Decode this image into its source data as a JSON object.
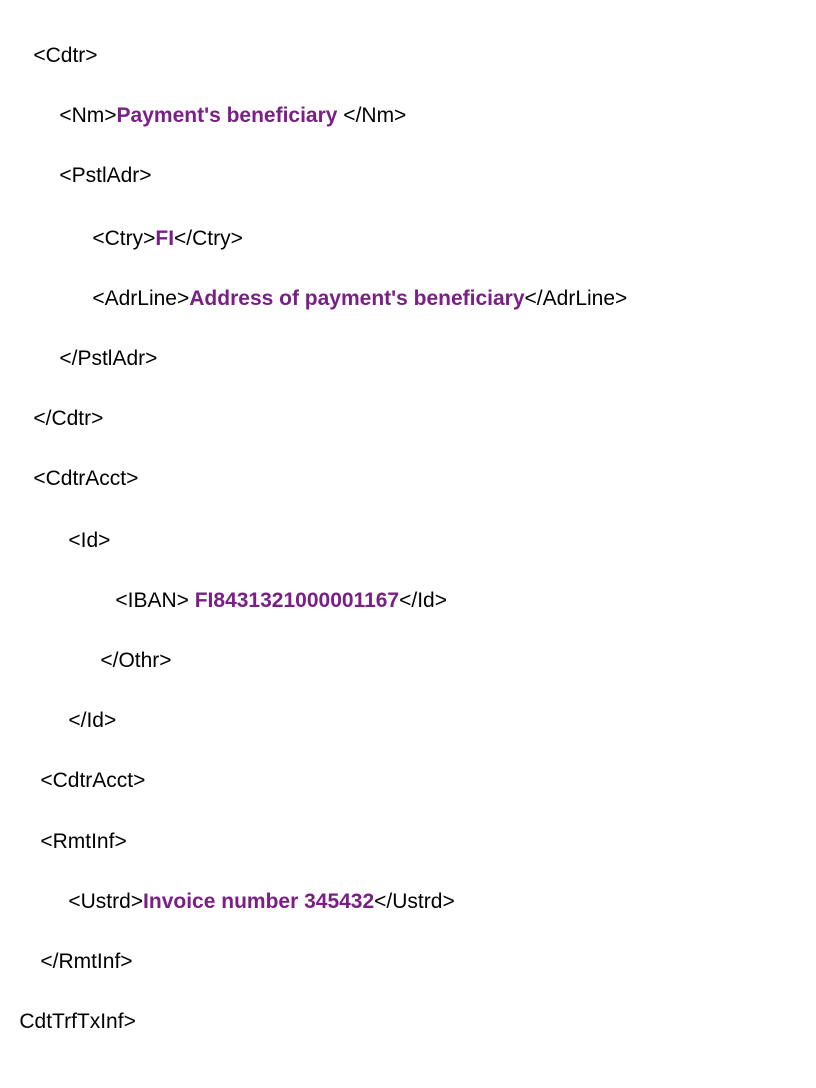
{
  "colors": {
    "text": "#000000",
    "value": "#7a1f86",
    "background": "#ffffff"
  },
  "lines": [
    {
      "pre": "<Cdtr>",
      "value": "",
      "post": ""
    },
    {
      "pre": "<Nm>",
      "value": "Payment's beneficiary",
      "post": " </Nm>"
    },
    {
      "pre": "<PstlAdr>",
      "value": "",
      "post": ""
    },
    {
      "pre": "<Ctry>",
      "value": "FI",
      "post": "</Ctry>"
    },
    {
      "pre": "<AdrLine>",
      "value": "Address of payment's beneficiary",
      "post": "</AdrLine>"
    },
    {
      "pre": "</PstlAdr>",
      "value": "",
      "post": ""
    },
    {
      "pre": "</Cdtr>",
      "value": "",
      "post": ""
    },
    {
      "pre": "<CdtrAcct>",
      "value": "",
      "post": ""
    },
    {
      "pre": "<Id>",
      "value": "",
      "post": ""
    },
    {
      "pre": "<IBAN> ",
      "value": "FI8431321000001167",
      "post": "</Id>"
    },
    {
      "pre": "</Othr>",
      "value": "",
      "post": ""
    },
    {
      "pre": "</Id>",
      "value": "",
      "post": ""
    },
    {
      "pre": "<CdtrAcct>",
      "value": "",
      "post": ""
    },
    {
      "pre": "<RmtInf>",
      "value": "",
      "post": ""
    },
    {
      "pre": "<Ustrd>",
      "value": "Invoice number 345432",
      "post": "</Ustrd>"
    },
    {
      "pre": "</RmtInf>",
      "value": "",
      "post": ""
    },
    {
      "pre": "CdtTrfTxInf>",
      "value": "",
      "post": ""
    }
  ]
}
